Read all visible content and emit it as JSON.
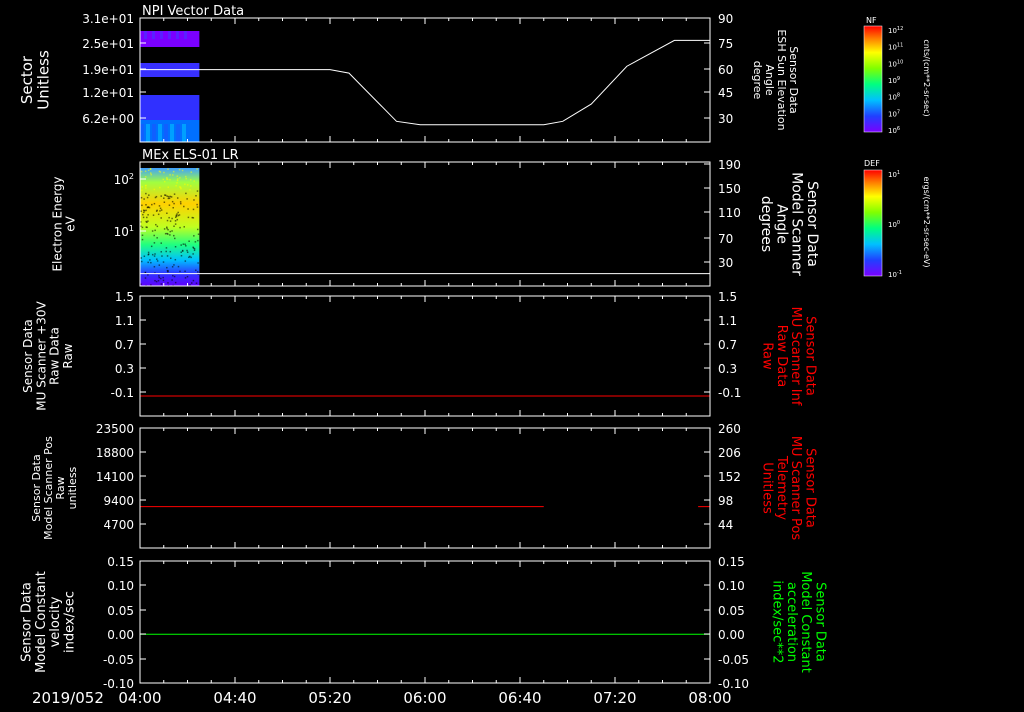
{
  "time_axis": {
    "date_label": "2019/052",
    "ticks": [
      "04:00",
      "04:40",
      "05:20",
      "06:00",
      "06:40",
      "07:20",
      "08:00"
    ]
  },
  "chart_data": [
    {
      "type": "heatmap",
      "title": "NPI Vector Data",
      "ylabel": [
        "Sector",
        "Unitless"
      ],
      "ytick_labels": [
        "3.1e+01",
        "2.5e+01",
        "1.9e+01",
        "1.2e+01",
        "6.2e+00"
      ],
      "ylim": [
        0,
        31
      ],
      "data_time_range": [
        "04:00",
        "04:25"
      ],
      "colorbar": {
        "label": "NF",
        "unit": "cnts/(cm**2-sr-sec)",
        "tick_labels": [
          "10^12",
          "10^11",
          "10^10",
          "10^9",
          "10^8",
          "10^7",
          "10^6"
        ]
      },
      "right_axis": {
        "label": [
          "Sensor Data",
          "ESH Sun Elevation",
          "Angle",
          "degree"
        ],
        "tick_labels": [
          "90",
          "75",
          "60",
          "45",
          "30"
        ],
        "ylim": [
          18,
          90
        ],
        "line": {
          "color": "#ffffff",
          "x": [
            "04:00",
            "05:20",
            "05:28",
            "05:38",
            "05:48",
            "05:58",
            "06:50",
            "06:58",
            "07:10",
            "07:25",
            "07:45",
            "08:00"
          ],
          "y": [
            60,
            60,
            58,
            44,
            30,
            28,
            28,
            30,
            40,
            62,
            77,
            77
          ]
        }
      }
    },
    {
      "type": "heatmap",
      "title": "MEx ELS-01 LR",
      "ylabel": [
        "Electron Energy",
        "eV"
      ],
      "yscale": "log",
      "ytick_labels": [
        "10^2",
        "10^1"
      ],
      "data_time_range": [
        "04:00",
        "04:25"
      ],
      "colorbar": {
        "label": "DEF",
        "unit": "ergs/(cm**2-sr-sec-eV)",
        "tick_labels": [
          "10^1",
          "10^0",
          "10^-1"
        ]
      },
      "right_axis": {
        "label": [
          "Sensor Data",
          "Model Scanner",
          "Angle",
          "degrees"
        ],
        "tick_labels": [
          "190",
          "150",
          "110",
          "70",
          "30"
        ],
        "ylim": [
          -10,
          190
        ],
        "line": {
          "color": "#ffffff",
          "x": [
            "04:00",
            "08:00"
          ],
          "y": [
            10,
            10
          ]
        }
      }
    },
    {
      "type": "line",
      "ylabel": [
        "Sensor Data",
        "MU Scanner +30V",
        "Raw Data",
        "Raw"
      ],
      "ytick_labels": [
        "1.5",
        "1.1",
        "0.7",
        "0.3",
        "-0.1"
      ],
      "ylim": [
        -0.3,
        1.5
      ],
      "right_axis": {
        "label": [
          "Sensor Data",
          "MU Scanner Inf",
          "Raw Data",
          "Raw"
        ],
        "label_color": "#ff0000",
        "tick_labels": [
          "1.5",
          "1.1",
          "0.7",
          "0.3",
          "-0.1"
        ],
        "ylim": [
          -0.3,
          1.5
        ]
      },
      "series": [
        {
          "color": "#ff0000",
          "x": [
            "04:00",
            "08:00"
          ],
          "y": [
            0.0,
            0.0
          ]
        }
      ]
    },
    {
      "type": "line",
      "ylabel": [
        "Sensor Data",
        "Model Scanner Pos",
        "Raw",
        "unitless"
      ],
      "ytick_labels": [
        "23500",
        "18800",
        "14100",
        "9400",
        "4700"
      ],
      "ylim": [
        0,
        23500
      ],
      "right_axis": {
        "label": [
          "Sensor Data",
          "MU Scanner Pos",
          "Telemetry",
          "Unitless"
        ],
        "label_color": "#ff0000",
        "tick_labels": [
          "260",
          "206",
          "152",
          "98",
          "44"
        ],
        "ylim": [
          0,
          260
        ]
      },
      "series": [
        {
          "color": "#ff0000",
          "x": [
            "04:00",
            "06:50"
          ],
          "y": [
            8100,
            8100
          ]
        },
        {
          "color": "#ff0000",
          "x": [
            "07:55",
            "08:00"
          ],
          "y": [
            8100,
            8100
          ]
        }
      ]
    },
    {
      "type": "line",
      "ylabel": [
        "Sensor Data",
        "Model Constant",
        "velocity",
        "index/sec"
      ],
      "ytick_labels": [
        "0.15",
        "0.10",
        "0.05",
        "0.00",
        "-0.05",
        "-0.10"
      ],
      "ylim": [
        -0.1,
        0.15
      ],
      "right_axis": {
        "label": [
          "Sensor Data",
          "Model Constant",
          "acceleration",
          "index/sec**2"
        ],
        "label_color": "#00ff00",
        "tick_labels": [
          "0.15",
          "0.10",
          "0.05",
          "0.00",
          "-0.05",
          "-0.10"
        ],
        "ylim": [
          -0.1,
          0.15
        ]
      },
      "series": [
        {
          "color": "#00ff00",
          "x": [
            "04:00",
            "08:00"
          ],
          "y": [
            0.0,
            0.0
          ]
        }
      ]
    }
  ]
}
